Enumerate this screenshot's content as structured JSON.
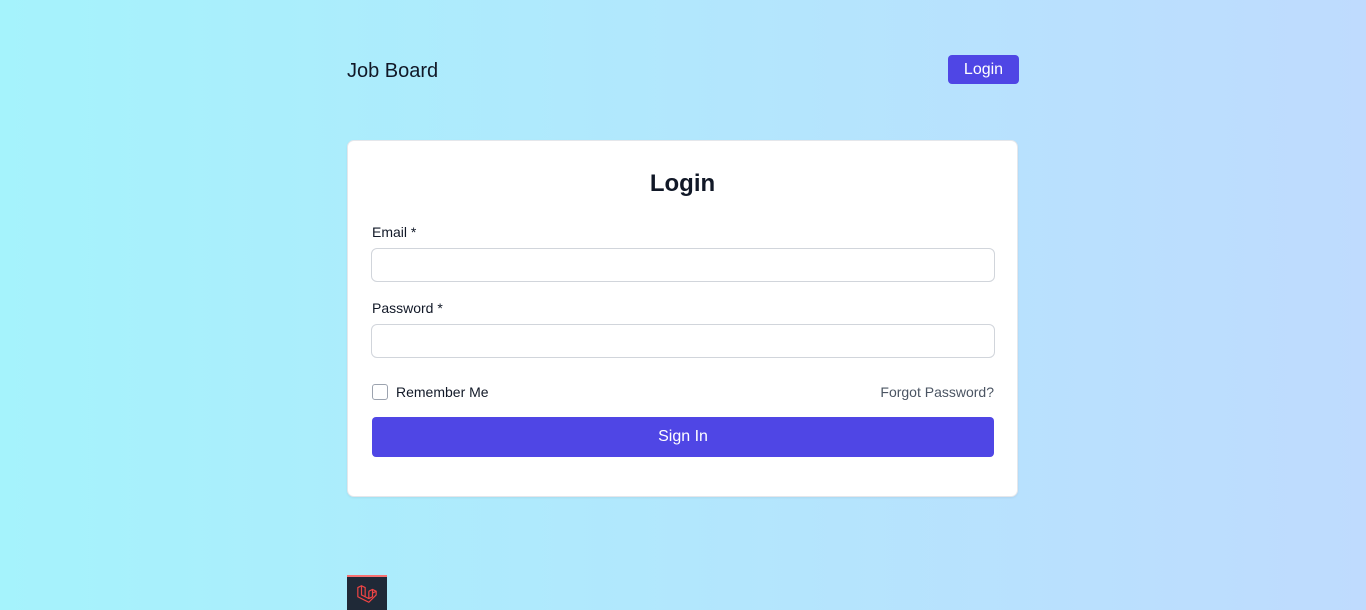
{
  "header": {
    "brand": "Job Board",
    "login_button": "Login"
  },
  "form": {
    "title": "Login",
    "email_label": "Email *",
    "email_value": "",
    "password_label": "Password *",
    "password_value": "",
    "remember_label": "Remember Me",
    "remember_checked": false,
    "forgot_link": "Forgot Password?",
    "submit_label": "Sign In"
  },
  "footer": {
    "badge_icon": "laravel-logo-icon"
  },
  "colors": {
    "accent": "#4f46e5",
    "gradient_start": "#a5f3fc",
    "gradient_end": "#bfdbfe",
    "debug_badge_bg": "#1f2937",
    "debug_badge_logo": "#ef4444"
  }
}
